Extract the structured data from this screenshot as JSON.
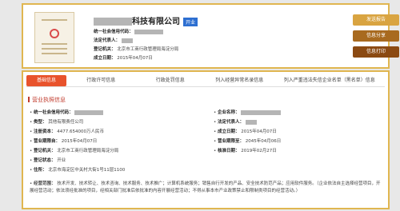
{
  "company": {
    "name_suffix": "科技有限公司",
    "status_badge": "开业"
  },
  "header": {
    "credit_code_label": "统一社会信用代码：",
    "legal_rep_label": "法定代表人：",
    "reg_authority_label": "登记机关：",
    "reg_authority_value": "北京市工商行政管理局海淀分局",
    "founded_label": "成立日期：",
    "founded_value": "2015年04月07日"
  },
  "actions": {
    "send_report": "发送报告",
    "share": "信息分享",
    "print": "信息打印"
  },
  "tabs": [
    "基础信息",
    "行政许可信息",
    "行政处罚信息",
    "列入经营异常名录信息",
    "列入严重违法失信企业名单（黑名单）信息"
  ],
  "section_title": "营业执照信息",
  "fields": {
    "credit_code_label": "统一社会信用代码：",
    "company_name_label": "企业名称：",
    "type_label": "类型：",
    "type_value": "其他有限责任公司",
    "legal_rep_label": "法定代表人：",
    "capital_label": "注册资本：",
    "capital_value": "4477.654000万人民币",
    "founded_label": "成立日期：",
    "founded_value": "2015年04月07日",
    "term_from_label": "营业期限自：",
    "term_from_value": "2015年04月07日",
    "term_to_label": "营业期限至：",
    "term_to_value": "2045年04月06日",
    "authority_label": "登记机关：",
    "authority_value": "北京市工商行政管理局海淀分局",
    "approval_label": "核准日期：",
    "approval_value": "2019年02月27日",
    "status_label": "登记状态：",
    "status_value": "开业",
    "address_label": "住所：",
    "address_value": "北京市海淀区中关村大街1号11层1100",
    "scope_label": "经营范围：",
    "scope_value": "技术开发、技术转让、技术咨询、技术服务、技术推广；计算机系统服务；销售自行开发的产品、安全技术防范产品；应用软件服务。（企业依法自主选择经营项目，开展经营活动；依法须经批准的项目，经相关部门批准后依批准的内容开展经营活动；不得从事本市产业政策禁止和限制类项目的经营活动。）"
  },
  "colors": {
    "accent": "#e8532c",
    "gold": "#e0b650",
    "btn1": "#d9a441",
    "btn2": "#a86a1f",
    "btn3": "#8b4a12",
    "badge": "#2d6fd1"
  }
}
